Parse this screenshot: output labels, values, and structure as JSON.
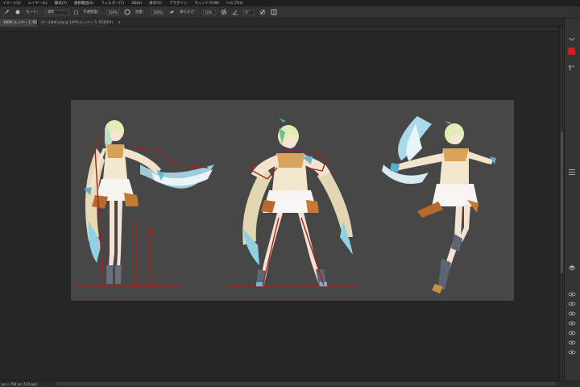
{
  "menubar": {
    "items": [
      "イメージ(I)",
      "レイヤー(L)",
      "書式(Y)",
      "選択範囲(S)",
      "フィルター(T)",
      "3D(D)",
      "表示(V)",
      "プラグイン",
      "ウィンドウ(W)",
      "ヘルプ(H)"
    ]
  },
  "options": {
    "mode_label": "モード：",
    "mode_value": "通常",
    "opacity_label": "不透明度：",
    "opacity_value": "100%",
    "flow_label": "流量：",
    "flow_value": "100%",
    "smoothing_label": "滑らかさ：",
    "smoothing_value": "10%",
    "angle_value": "0°"
  },
  "tabs": [
    {
      "label": "100% (レイヤー 1, RGB/8) *",
      "close": "×"
    },
    {
      "label": "ポーズ参考.png @ 100% (レイヤー 1, RGB/8#)",
      "close": "×"
    }
  ],
  "status": {
    "text": "px × 700 px (120 ppi)"
  },
  "colors": {
    "foreground_swatch": "#d51d1d",
    "guide_lines": "#9e2222"
  }
}
